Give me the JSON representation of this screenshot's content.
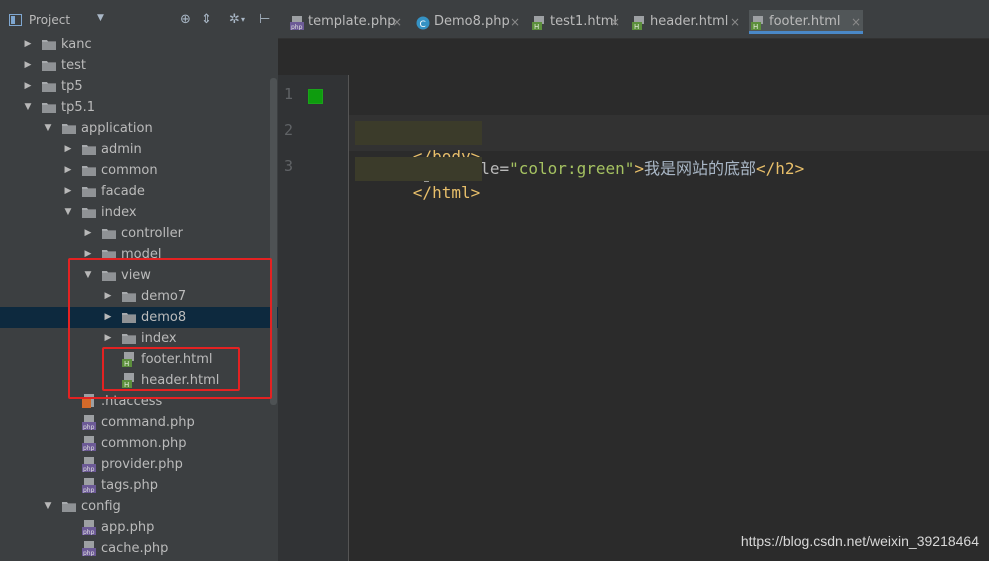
{
  "sidebar": {
    "title": "Project",
    "toolbar_icons": [
      "target-icon",
      "collapse-icon",
      "gear-icon",
      "hide-icon"
    ],
    "items": [
      {
        "label": "kanc",
        "type": "folder",
        "depth": 1,
        "expanded": false
      },
      {
        "label": "test",
        "type": "folder",
        "depth": 1,
        "expanded": false
      },
      {
        "label": "tp5",
        "type": "folder",
        "depth": 1,
        "expanded": false
      },
      {
        "label": "tp5.1",
        "type": "folder",
        "depth": 1,
        "expanded": true
      },
      {
        "label": "application",
        "type": "folder",
        "depth": 2,
        "expanded": true
      },
      {
        "label": "admin",
        "type": "folder",
        "depth": 3,
        "expanded": false
      },
      {
        "label": "common",
        "type": "folder",
        "depth": 3,
        "expanded": false
      },
      {
        "label": "facade",
        "type": "folder",
        "depth": 3,
        "expanded": false
      },
      {
        "label": "index",
        "type": "folder",
        "depth": 3,
        "expanded": true
      },
      {
        "label": "controller",
        "type": "folder",
        "depth": 4,
        "expanded": false
      },
      {
        "label": "model",
        "type": "folder",
        "depth": 4,
        "expanded": false
      },
      {
        "label": "view",
        "type": "folder",
        "depth": 4,
        "expanded": true
      },
      {
        "label": "demo7",
        "type": "folder",
        "depth": 5,
        "expanded": false
      },
      {
        "label": "demo8",
        "type": "folder",
        "depth": 5,
        "expanded": false,
        "selected": true
      },
      {
        "label": "index",
        "type": "folder",
        "depth": 5,
        "expanded": false
      },
      {
        "label": "footer.html",
        "type": "html",
        "depth": 5
      },
      {
        "label": "header.html",
        "type": "html",
        "depth": 5
      },
      {
        "label": ".htaccess",
        "type": "htaccess",
        "depth": 3
      },
      {
        "label": "command.php",
        "type": "php",
        "depth": 3
      },
      {
        "label": "common.php",
        "type": "php",
        "depth": 3
      },
      {
        "label": "provider.php",
        "type": "php",
        "depth": 3
      },
      {
        "label": "tags.php",
        "type": "php",
        "depth": 3
      },
      {
        "label": "config",
        "type": "folder",
        "depth": 2,
        "expanded": true
      },
      {
        "label": "app.php",
        "type": "php",
        "depth": 3
      },
      {
        "label": "cache.php",
        "type": "php",
        "depth": 3
      }
    ]
  },
  "tabs": [
    {
      "label": "template.php",
      "type": "php",
      "active": false
    },
    {
      "label": "Demo8.php",
      "type": "class",
      "active": false
    },
    {
      "label": "test1.html",
      "type": "html",
      "active": false
    },
    {
      "label": "header.html",
      "type": "html",
      "active": false
    },
    {
      "label": "footer.html",
      "type": "html",
      "active": true
    }
  ],
  "tab_close": "×",
  "editor": {
    "line_numbers": [
      "1",
      "2",
      "3"
    ],
    "lines": [
      {
        "open_tag": "h2",
        "attr": "style=",
        "value": "\"color:green\"",
        "text": "我是网站的底部",
        "close_tag": "h2"
      },
      {
        "tag_prefix": "<",
        "tag_name": "/body>"
      },
      {
        "tag_prefix": "</",
        "tag_name": "html>"
      }
    ]
  },
  "watermark": "https://blog.csdn.net/weixin_39218464",
  "colors": {
    "sidebar_bg": "#3c3f41",
    "editor_bg": "#2b2b2b",
    "selection": "#0d293e",
    "highlight_box": "#e42222",
    "tag": "#e8bf6a",
    "string": "#a5c261",
    "active_tab_underline": "#4a88c7"
  }
}
